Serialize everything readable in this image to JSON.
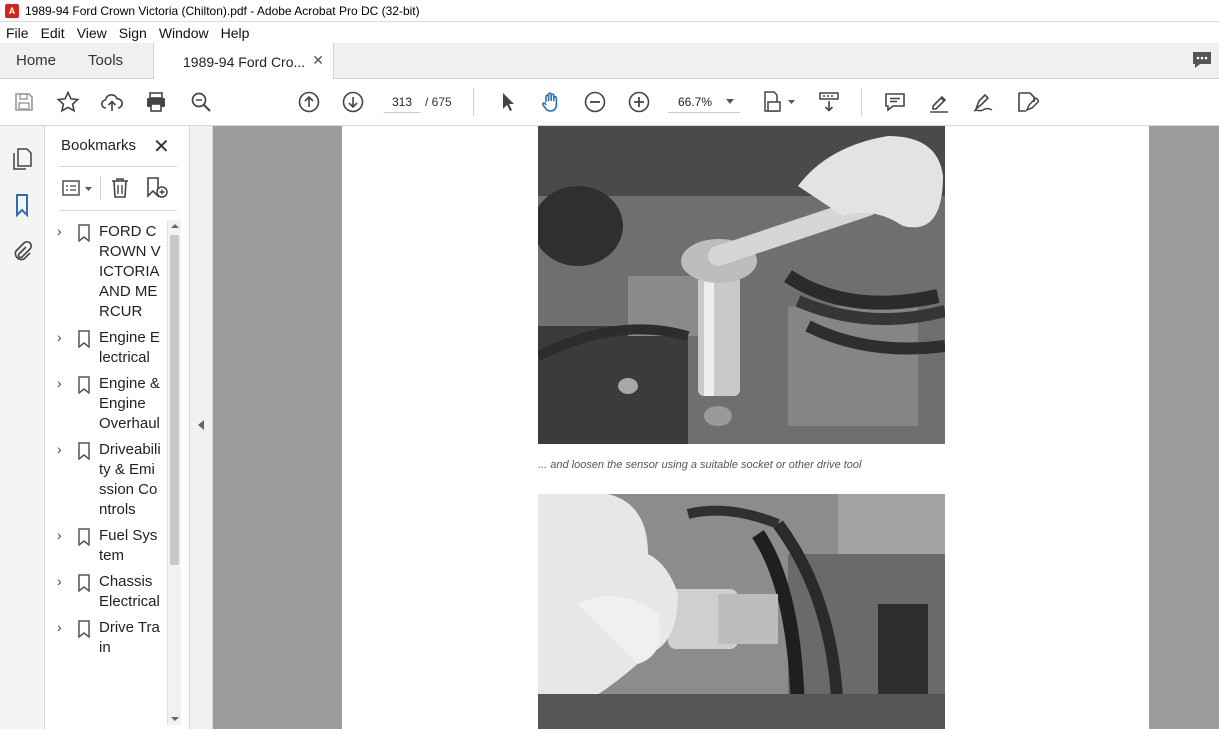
{
  "window": {
    "title": "1989-94 Ford Crown Victoria (Chilton).pdf - Adobe Acrobat Pro DC (32-bit)"
  },
  "menu": [
    "File",
    "Edit",
    "View",
    "Sign",
    "Window",
    "Help"
  ],
  "tabs": {
    "home": "Home",
    "tools": "Tools",
    "document": "1989-94 Ford Cro..."
  },
  "toolbar": {
    "page_current": "313",
    "page_total": "/ 675",
    "zoom": "66.7%"
  },
  "bookmarks": {
    "header": "Bookmarks",
    "items": [
      {
        "label": "FORD CROWN VICTORIA AND MERCUR"
      },
      {
        "label": "Engine Electrical"
      },
      {
        "label": "Engine & Engine Overhaul"
      },
      {
        "label": "Driveability & Emission Controls"
      },
      {
        "label": "Fuel System"
      },
      {
        "label": "Chassis Electrical"
      },
      {
        "label": "Drive Train"
      }
    ]
  },
  "document": {
    "caption": "... and loosen the sensor using a suitable socket or other drive tool"
  },
  "colors": {
    "accent": "#2d6fb3",
    "pdf_icon": "#d4251a",
    "canvas": "#9c9c9c"
  }
}
